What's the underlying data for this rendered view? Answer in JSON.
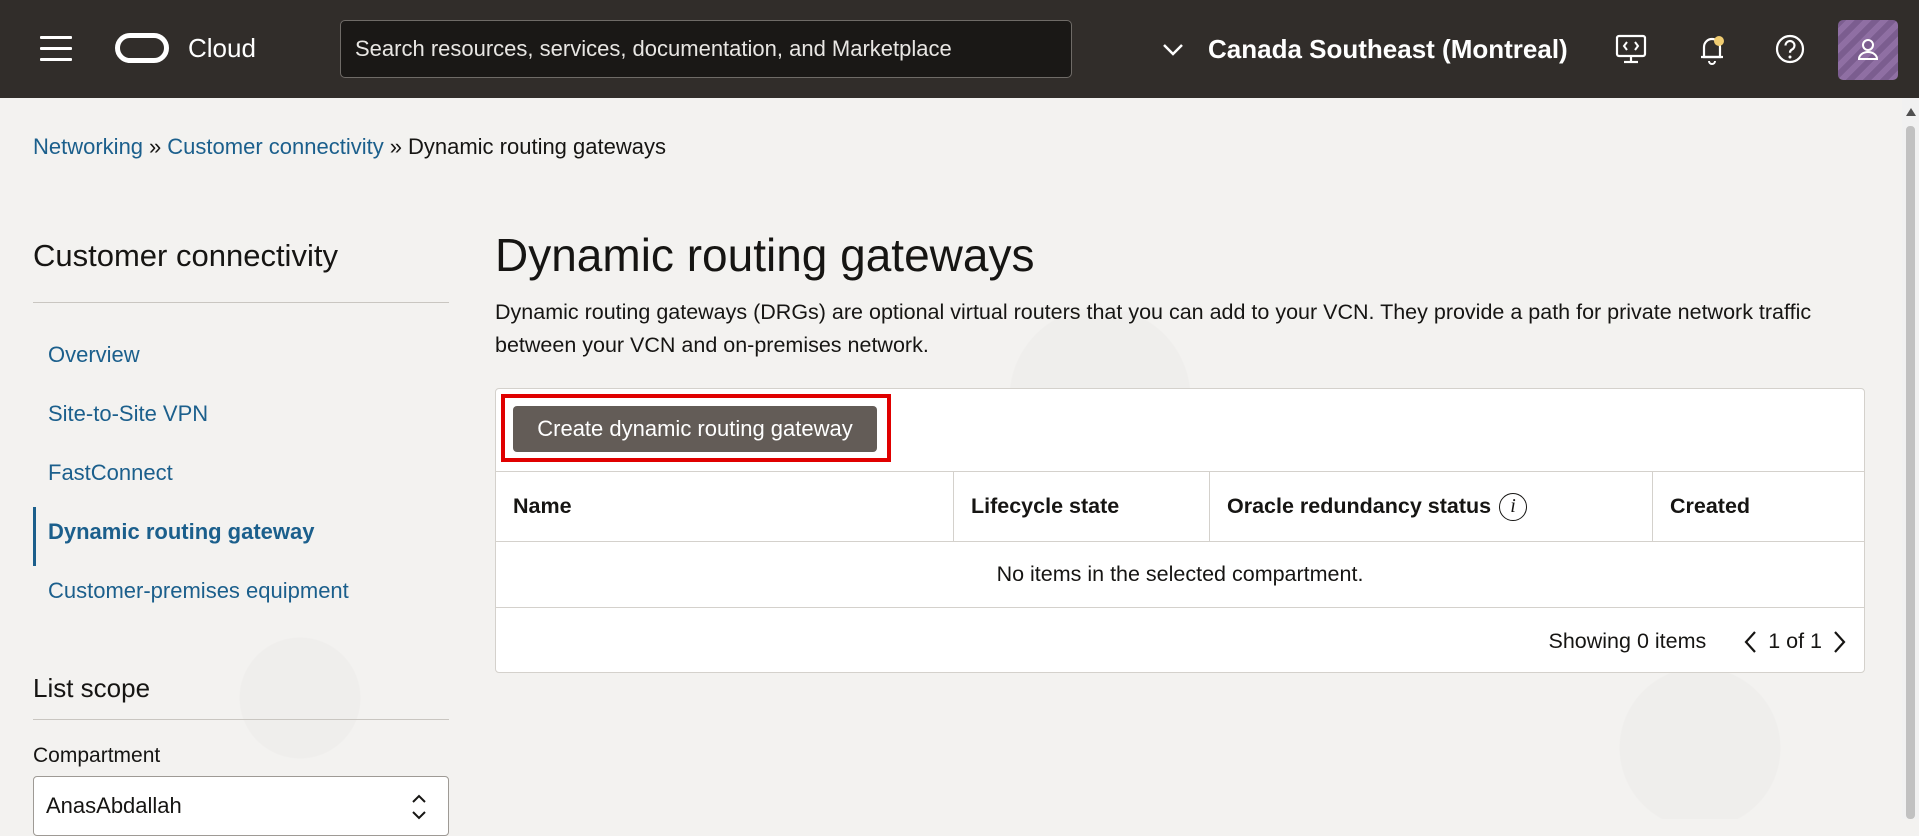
{
  "header": {
    "brand": "Cloud",
    "search_placeholder": "Search resources, services, documentation, and Marketplace",
    "region": "Canada Southeast (Montreal)"
  },
  "breadcrumb": {
    "items": [
      "Networking",
      "Customer connectivity",
      "Dynamic routing gateways"
    ],
    "separator": "»"
  },
  "sidebar": {
    "title": "Customer connectivity",
    "items": [
      {
        "label": "Overview"
      },
      {
        "label": "Site-to-Site VPN"
      },
      {
        "label": "FastConnect"
      },
      {
        "label": "Dynamic routing gateway"
      },
      {
        "label": "Customer-premises equipment"
      }
    ],
    "scope_title": "List scope",
    "compartment_label": "Compartment",
    "compartment_value": "AnasAbdallah"
  },
  "main": {
    "title": "Dynamic routing gateways",
    "description": "Dynamic routing gateways (DRGs) are optional virtual routers that you can add to your VCN. They provide a path for private network traffic between your VCN and on-premises network.",
    "create_button": "Create dynamic routing gateway",
    "table": {
      "columns": [
        "Name",
        "Lifecycle state",
        "Oracle redundancy status",
        "Created"
      ],
      "empty_message": "No items in the selected compartment."
    },
    "pager": {
      "showing": "Showing 0 items",
      "page": "1 of 1"
    }
  },
  "colors": {
    "header_bg": "#312d2a",
    "link": "#1b5f8c",
    "button_bg": "#635c57",
    "highlight": "#e00000"
  },
  "icons": [
    "menu-icon",
    "oracle-logo-icon",
    "chevron-down-icon",
    "developer-tools-icon",
    "bell-icon",
    "help-icon",
    "user-icon",
    "info-icon",
    "chevron-left-icon",
    "chevron-right-icon",
    "select-chevrons-icon"
  ]
}
